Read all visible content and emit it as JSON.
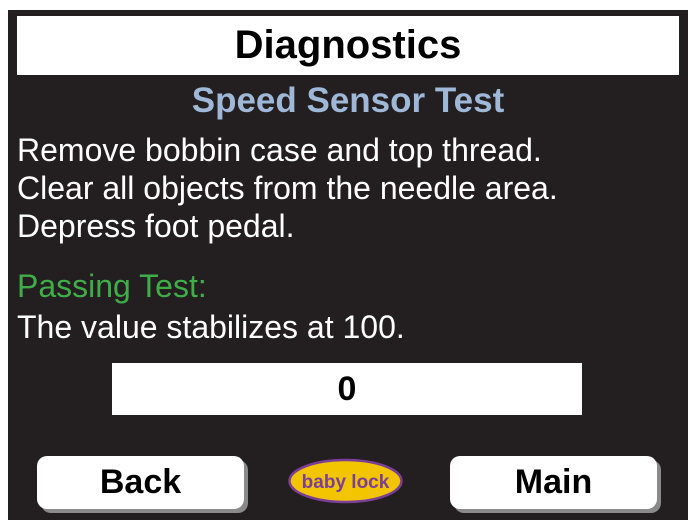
{
  "header": {
    "title": "Diagnostics",
    "subtitle": "Speed Sensor Test"
  },
  "instructions": {
    "lines": [
      "Remove bobbin case and top thread.",
      "Clear all objects from the needle area.",
      "Depress foot pedal."
    ]
  },
  "passing": {
    "label": "Passing Test:",
    "text": "The value stabilizes at 100."
  },
  "readout": {
    "value": "0"
  },
  "footer": {
    "back_label": "Back",
    "main_label": "Main",
    "logo_text": "baby lock"
  },
  "colors": {
    "background": "#231f20",
    "subtitle": "#9fb8d7",
    "pass_label": "#3fae49",
    "logo_fill": "#f2c500",
    "logo_text": "#7b3f98"
  }
}
